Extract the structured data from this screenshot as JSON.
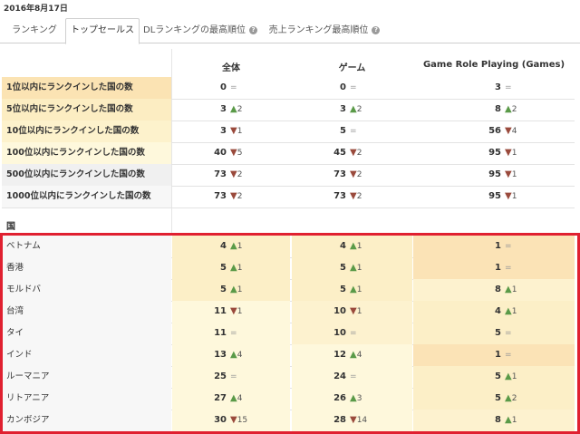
{
  "date": "2016年8月17日",
  "tabs": [
    {
      "label": "ランキング",
      "active": false,
      "help": false
    },
    {
      "label": "トップセールス",
      "active": true,
      "help": false
    },
    {
      "label": "DLランキングの最高順位",
      "active": false,
      "help": true
    },
    {
      "label": "売上ランキング最高順位",
      "active": false,
      "help": true
    }
  ],
  "help_glyph": "?",
  "columns": [
    "全体",
    "ゲーム",
    "Game Role Playing (Games)"
  ],
  "summary_rows": [
    {
      "label": "1位以内にランクインした国の数",
      "bg": "#fbe3b3",
      "cells": [
        {
          "v": "0",
          "t": "eq",
          "d": ""
        },
        {
          "v": "0",
          "t": "eq",
          "d": ""
        },
        {
          "v": "3",
          "t": "eq",
          "d": ""
        }
      ]
    },
    {
      "label": "5位以内にランクインした国の数",
      "bg": "#fcedc2",
      "cells": [
        {
          "v": "3",
          "t": "up",
          "d": "2"
        },
        {
          "v": "3",
          "t": "up",
          "d": "2"
        },
        {
          "v": "8",
          "t": "up",
          "d": "2"
        }
      ]
    },
    {
      "label": "10位以内にランクインした国の数",
      "bg": "#fdf2cc",
      "cells": [
        {
          "v": "3",
          "t": "dn",
          "d": "1"
        },
        {
          "v": "5",
          "t": "eq",
          "d": ""
        },
        {
          "v": "56",
          "t": "dn",
          "d": "4"
        }
      ]
    },
    {
      "label": "100位以内にランクインした国の数",
      "bg": "#fef8dc",
      "cells": [
        {
          "v": "40",
          "t": "dn",
          "d": "5"
        },
        {
          "v": "45",
          "t": "dn",
          "d": "2"
        },
        {
          "v": "95",
          "t": "dn",
          "d": "1"
        }
      ]
    },
    {
      "label": "500位以内にランクインした国の数",
      "bg": "#f0f0f0",
      "cells": [
        {
          "v": "73",
          "t": "dn",
          "d": "2"
        },
        {
          "v": "73",
          "t": "dn",
          "d": "2"
        },
        {
          "v": "95",
          "t": "dn",
          "d": "1"
        }
      ]
    },
    {
      "label": "1000位以内にランクインした国の数",
      "bg": "#f7f7f7",
      "cells": [
        {
          "v": "73",
          "t": "dn",
          "d": "2"
        },
        {
          "v": "73",
          "t": "dn",
          "d": "2"
        },
        {
          "v": "95",
          "t": "dn",
          "d": "1"
        }
      ]
    }
  ],
  "country_header": "国",
  "country_rows": [
    {
      "label": "ベトナム",
      "cells": [
        {
          "v": "4",
          "t": "up",
          "d": "1",
          "bg": "#fcefc7"
        },
        {
          "v": "4",
          "t": "up",
          "d": "1",
          "bg": "#fcefc7"
        },
        {
          "v": "1",
          "t": "eq",
          "d": "",
          "bg": "#fbe3b6"
        }
      ]
    },
    {
      "label": "香港",
      "cells": [
        {
          "v": "5",
          "t": "up",
          "d": "1",
          "bg": "#fcefc7"
        },
        {
          "v": "5",
          "t": "up",
          "d": "1",
          "bg": "#fcefc7"
        },
        {
          "v": "1",
          "t": "eq",
          "d": "",
          "bg": "#fbe3b6"
        }
      ]
    },
    {
      "label": "モルドバ",
      "cells": [
        {
          "v": "5",
          "t": "up",
          "d": "1",
          "bg": "#fcefc7"
        },
        {
          "v": "5",
          "t": "up",
          "d": "1",
          "bg": "#fcefc7"
        },
        {
          "v": "8",
          "t": "up",
          "d": "1",
          "bg": "#fdf2cf"
        }
      ]
    },
    {
      "label": "台湾",
      "cells": [
        {
          "v": "11",
          "t": "dn",
          "d": "1",
          "bg": "#fef8dc"
        },
        {
          "v": "10",
          "t": "dn",
          "d": "1",
          "bg": "#fdf2cf"
        },
        {
          "v": "4",
          "t": "up",
          "d": "1",
          "bg": "#fcefc7"
        }
      ]
    },
    {
      "label": "タイ",
      "cells": [
        {
          "v": "11",
          "t": "eq",
          "d": "",
          "bg": "#fef8dc"
        },
        {
          "v": "10",
          "t": "eq",
          "d": "",
          "bg": "#fdf2cf"
        },
        {
          "v": "5",
          "t": "eq",
          "d": "",
          "bg": "#fcefc7"
        }
      ]
    },
    {
      "label": "インド",
      "cells": [
        {
          "v": "13",
          "t": "up",
          "d": "4",
          "bg": "#fef8dc"
        },
        {
          "v": "12",
          "t": "up",
          "d": "4",
          "bg": "#fef8dc"
        },
        {
          "v": "1",
          "t": "eq",
          "d": "",
          "bg": "#fbe3b6"
        }
      ]
    },
    {
      "label": "ルーマニア",
      "cells": [
        {
          "v": "25",
          "t": "eq",
          "d": "",
          "bg": "#fef8dc"
        },
        {
          "v": "24",
          "t": "eq",
          "d": "",
          "bg": "#fef8dc"
        },
        {
          "v": "5",
          "t": "up",
          "d": "1",
          "bg": "#fcefc7"
        }
      ]
    },
    {
      "label": "リトアニア",
      "cells": [
        {
          "v": "27",
          "t": "up",
          "d": "4",
          "bg": "#fef8dc"
        },
        {
          "v": "26",
          "t": "up",
          "d": "3",
          "bg": "#fef8dc"
        },
        {
          "v": "5",
          "t": "up",
          "d": "2",
          "bg": "#fcefc7"
        }
      ]
    },
    {
      "label": "カンボジア",
      "cells": [
        {
          "v": "30",
          "t": "dn",
          "d": "15",
          "bg": "#fef8dc"
        },
        {
          "v": "28",
          "t": "dn",
          "d": "14",
          "bg": "#fef8dc"
        },
        {
          "v": "8",
          "t": "up",
          "d": "1",
          "bg": "#fdf2cf"
        }
      ]
    }
  ],
  "symbols": {
    "up": "▲",
    "dn": "▼",
    "eq": "="
  },
  "highlight_color": "#e02030"
}
